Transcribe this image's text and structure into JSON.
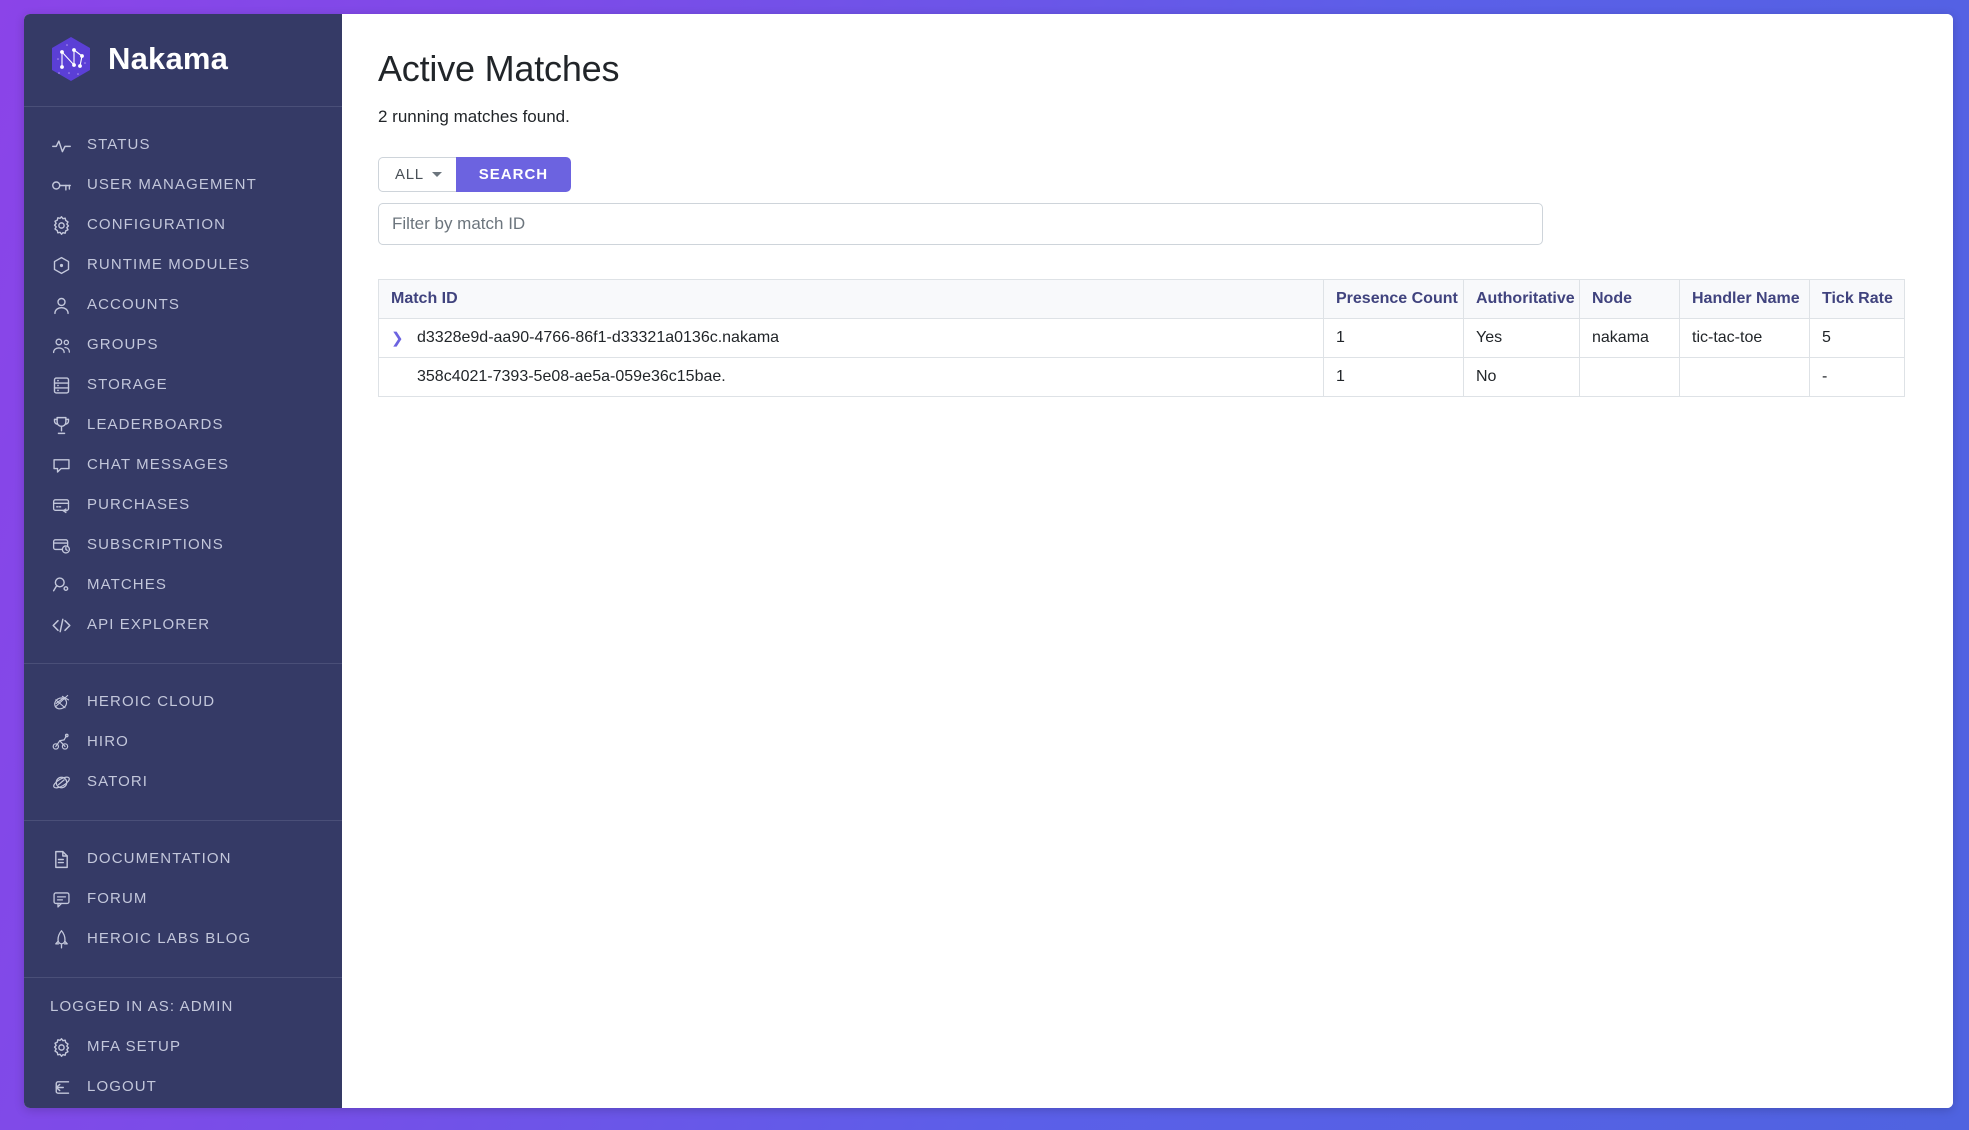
{
  "brand": {
    "name": "Nakama",
    "logo_icon": "nakama-hex-logo"
  },
  "sidebar": {
    "groups": [
      {
        "name": "primary",
        "items": [
          {
            "label": "STATUS",
            "icon": "activity-pulse-icon"
          },
          {
            "label": "USER MANAGEMENT",
            "icon": "key-icon"
          },
          {
            "label": "CONFIGURATION",
            "icon": "gear-icon"
          },
          {
            "label": "RUNTIME MODULES",
            "icon": "hexagon-dot-icon"
          },
          {
            "label": "ACCOUNTS",
            "icon": "user-icon"
          },
          {
            "label": "GROUPS",
            "icon": "users-group-icon"
          },
          {
            "label": "STORAGE",
            "icon": "database-icon"
          },
          {
            "label": "LEADERBOARDS",
            "icon": "trophy-icon"
          },
          {
            "label": "CHAT MESSAGES",
            "icon": "chat-bubble-icon"
          },
          {
            "label": "PURCHASES",
            "icon": "card-return-icon"
          },
          {
            "label": "SUBSCRIPTIONS",
            "icon": "card-clock-icon"
          },
          {
            "label": "MATCHES",
            "icon": "magnifier-dot-icon"
          },
          {
            "label": "API EXPLORER",
            "icon": "code-brackets-icon"
          }
        ]
      },
      {
        "name": "products",
        "items": [
          {
            "label": "HEROIC CLOUD",
            "icon": "heroic-cloud-icon"
          },
          {
            "label": "HIRO",
            "icon": "hiro-icon"
          },
          {
            "label": "SATORI",
            "icon": "satori-icon"
          }
        ]
      },
      {
        "name": "resources",
        "items": [
          {
            "label": "DOCUMENTATION",
            "icon": "document-icon"
          },
          {
            "label": "FORUM",
            "icon": "forum-icon"
          },
          {
            "label": "HEROIC LABS BLOG",
            "icon": "rocket-icon"
          }
        ]
      }
    ],
    "account": {
      "logged_in_as": "LOGGED IN AS: ADMIN",
      "items": [
        {
          "label": "MFA SETUP",
          "icon": "gear-icon"
        },
        {
          "label": "LOGOUT",
          "icon": "logout-arrow-icon"
        }
      ]
    }
  },
  "main": {
    "title": "Active Matches",
    "subtitle": "2 running matches found.",
    "filter_button_label": "ALL",
    "search_button_label": "SEARCH",
    "filter_input_placeholder": "Filter by match ID",
    "filter_input_value": "",
    "table": {
      "columns": [
        "Match ID",
        "Presence Count",
        "Authoritative",
        "Node",
        "Handler Name",
        "Tick Rate"
      ],
      "rows": [
        {
          "expandable": true,
          "expand_icon": "chevron-right-icon",
          "match_id": "d3328e9d-aa90-4766-86f1-d33321a0136c.nakama",
          "presence_count": "1",
          "authoritative": "Yes",
          "node": "nakama",
          "handler_name": "tic-tac-toe",
          "tick_rate": "5"
        },
        {
          "expandable": false,
          "expand_icon": "",
          "match_id": "358c4021-7393-5e08-ae5a-059e36c15bae.",
          "presence_count": "1",
          "authoritative": "No",
          "node": "",
          "handler_name": "",
          "tick_rate": "-"
        }
      ]
    }
  },
  "colors": {
    "sidebar_bg": "#353a66",
    "accent": "#6c63e0",
    "page_bg_gradient_start": "#8b44e8",
    "page_bg_gradient_end": "#4f63e0",
    "table_header_text": "#40437e"
  }
}
